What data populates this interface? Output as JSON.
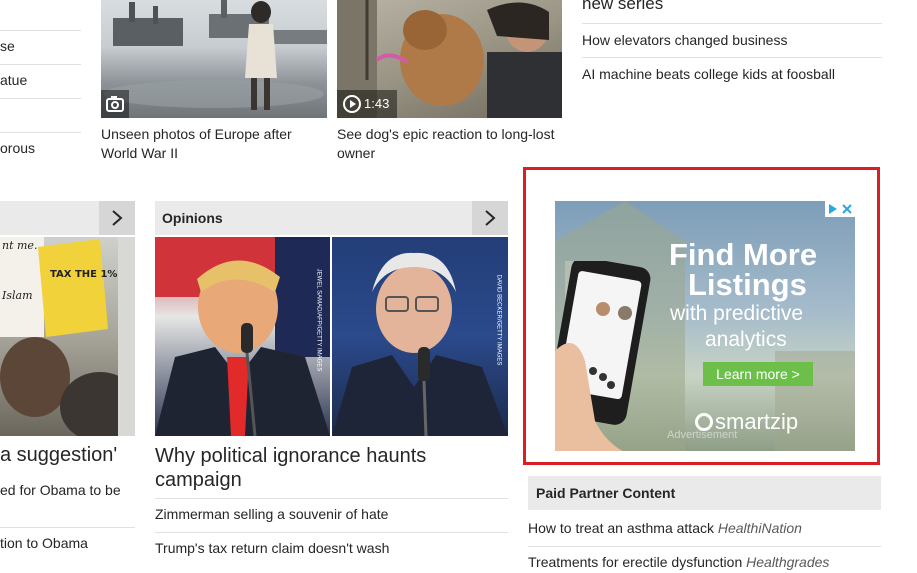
{
  "left_column": {
    "links": [
      "se",
      "atue",
      "orous"
    ]
  },
  "top_cards": [
    {
      "caption": "Unseen photos of Europe after World War II",
      "media": "camera-icon"
    },
    {
      "caption": "See dog's epic reaction to long-lost owner",
      "media": "play-icon",
      "duration": "1:43"
    }
  ],
  "right_top": {
    "heading_partial": "new series",
    "links": [
      "How elevators changed business",
      "AI machine beats college kids at foosball"
    ]
  },
  "left_section": {
    "headline_partial": "a suggestion'",
    "links": [
      "ed for Obama to be",
      "tion to Obama"
    ],
    "sign_text": [
      "TAX THE 1%",
      "nt me.",
      "Islam"
    ]
  },
  "opinions": {
    "title": "Opinions",
    "headline": "Why political ignorance haunts campaign",
    "links": [
      "Zimmerman selling a souvenir of hate",
      "Trump's tax return claim doesn't wash"
    ],
    "image_credits": [
      "JEWEL SAMAD/AFP/GETTY IMAGES",
      "DAVID BECKER/GETTY IMAGES"
    ]
  },
  "ad": {
    "headline_lines": [
      "Find More",
      "Listings"
    ],
    "sub_lines": [
      "with predictive",
      "analytics"
    ],
    "cta": "Learn more >",
    "brand": "smartzip",
    "watermark": "Advertisement",
    "colors": {
      "cta_bg": "#6cc04a",
      "outline": "#d81f26"
    }
  },
  "paid_partner": {
    "title": "Paid Partner Content",
    "items": [
      {
        "text": "How to treat an asthma attack",
        "source": "HealthiNation"
      },
      {
        "text": "Treatments for erectile dysfunction",
        "source": "Healthgrades"
      }
    ]
  }
}
